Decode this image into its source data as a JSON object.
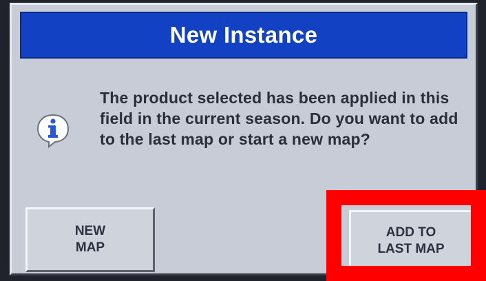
{
  "dialog": {
    "title": "New Instance",
    "message": "The product selected has been applied in this field in the current season.  Do you want to add to the last map or start a new map?",
    "icon": "info-icon",
    "buttons": {
      "new_map_line1": "NEW",
      "new_map_line2": "MAP",
      "add_line1": "ADD TO",
      "add_line2": "LAST MAP"
    }
  },
  "colors": {
    "title_bar": "#1241c4",
    "dialog_bg": "#c7ccd6",
    "highlight": "#ff0000"
  }
}
